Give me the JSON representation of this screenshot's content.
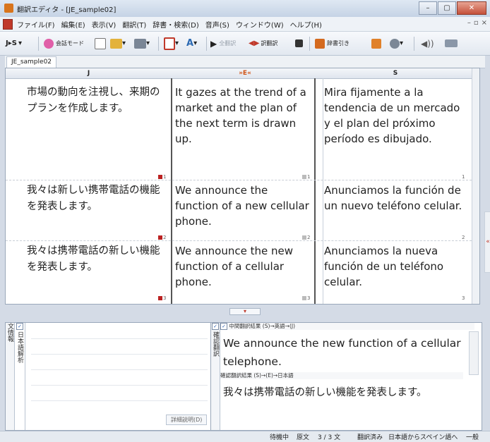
{
  "window": {
    "title": "翻訳エディタ - [JE_sample02]",
    "buttons": [
      "–",
      "▢",
      "✕"
    ]
  },
  "menu": {
    "items": [
      "ファイル(F)",
      "編集(E)",
      "表示(V)",
      "翻訳(T)",
      "辞書・検索(D)",
      "音声(S)",
      "ウィンドウ(W)",
      "ヘルプ(H)"
    ],
    "mdi_buttons": [
      "–",
      "▫",
      "×"
    ]
  },
  "toolbar": {
    "lang_label": "J▸S",
    "chat_mode": "会話モード",
    "translate_label": "全翻訳",
    "retranslate_label": "訳翻訳",
    "dict_lookup": "辞書引き"
  },
  "tab": {
    "label": "JE_sample02"
  },
  "columns": {
    "j": "J",
    "e": "»E«",
    "s": "S"
  },
  "rows": [
    {
      "ja": "市場の動向を注視し、来期のプランを作成します。",
      "en": "It gazes at the trend of a market and the plan of the next term is drawn up.",
      "es": "Mira fijamente a la tendencia de un mercado y el plan del próximo período es dibujado.",
      "num": "1"
    },
    {
      "ja": "我々は新しい携帯電話の機能を発表します。",
      "en": "We announce the function of a new cellular phone.",
      "es": "Anunciamos la función de un nuevo teléfono celular.",
      "num": "2"
    },
    {
      "ja": "我々は携帯電話の新しい機能を発表します。",
      "en": "We announce the new function of a cellular phone.",
      "es": "Anunciamos la nueva función de un teléfono celular.",
      "num": "3"
    }
  ],
  "bottom": {
    "left_tab": "文情報",
    "left_subtab": "日本語解析",
    "detail_button": "詳細説明(D)",
    "right_tab": "確認翻訳",
    "intermediate_header": "中間翻訳結果 (S)→英語→(J)",
    "intermediate_text": "We announce the new function of a cellular telephone.",
    "confirm_header": "確認翻訳結果 (S)→(E)→日本語",
    "confirm_text": "我々は携帯電話の新しい機能を発表します。"
  },
  "status": {
    "state": "待機中",
    "source": "原文",
    "count": "3 / 3 文",
    "translated": "翻訳済み",
    "direction": "日本語からスペイン語へ",
    "mode": "一般"
  }
}
